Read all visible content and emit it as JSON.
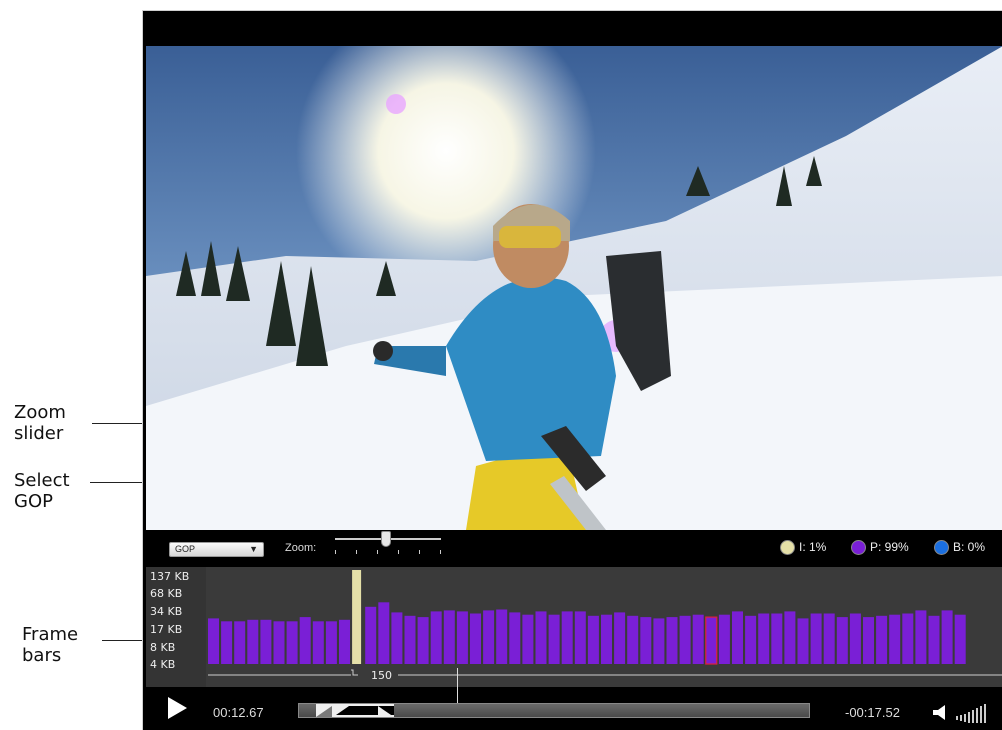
{
  "callouts": {
    "zoom": [
      "Zoom",
      "slider"
    ],
    "gop": [
      "Select",
      "GOP"
    ],
    "frames": [
      "Frame",
      "bars"
    ]
  },
  "controls": {
    "gop_select_value": "GOP",
    "zoom_label": "Zoom:",
    "zoom_level": 0.52,
    "legend": [
      {
        "label": "I: 1%",
        "color": "#e5e0a8"
      },
      {
        "label": "P: 99%",
        "color": "#7a1fd6"
      },
      {
        "label": "B: 0%",
        "color": "#1b6fe0"
      }
    ]
  },
  "graph": {
    "y_labels": [
      "137 KB",
      "68 KB",
      "34 KB",
      "17 KB",
      "8 KB",
      "4 KB"
    ],
    "gop_length_label": "150",
    "colors": {
      "p_frame": "#7a1fd6",
      "i_frame": "#e5e0a8",
      "selected": "#e0203a"
    },
    "frames": [
      {
        "type": "P",
        "size_kb": 17
      },
      {
        "type": "P",
        "size_kb": 15
      },
      {
        "type": "P",
        "size_kb": 15
      },
      {
        "type": "P",
        "size_kb": 16
      },
      {
        "type": "P",
        "size_kb": 16
      },
      {
        "type": "P",
        "size_kb": 15
      },
      {
        "type": "P",
        "size_kb": 15
      },
      {
        "type": "P",
        "size_kb": 18
      },
      {
        "type": "P",
        "size_kb": 15
      },
      {
        "type": "P",
        "size_kb": 15
      },
      {
        "type": "P",
        "size_kb": 16
      },
      {
        "type": "I",
        "size_kb": 137
      },
      {
        "type": "P",
        "size_kb": 28
      },
      {
        "type": "P",
        "size_kb": 34
      },
      {
        "type": "P",
        "size_kb": 22
      },
      {
        "type": "P",
        "size_kb": 19
      },
      {
        "type": "P",
        "size_kb": 18
      },
      {
        "type": "P",
        "size_kb": 23
      },
      {
        "type": "P",
        "size_kb": 24
      },
      {
        "type": "P",
        "size_kb": 23
      },
      {
        "type": "P",
        "size_kb": 21
      },
      {
        "type": "P",
        "size_kb": 24
      },
      {
        "type": "P",
        "size_kb": 25
      },
      {
        "type": "P",
        "size_kb": 22
      },
      {
        "type": "P",
        "size_kb": 20
      },
      {
        "type": "P",
        "size_kb": 23
      },
      {
        "type": "P",
        "size_kb": 20
      },
      {
        "type": "P",
        "size_kb": 23
      },
      {
        "type": "P",
        "size_kb": 23
      },
      {
        "type": "P",
        "size_kb": 19
      },
      {
        "type": "P",
        "size_kb": 20
      },
      {
        "type": "P",
        "size_kb": 22
      },
      {
        "type": "P",
        "size_kb": 19
      },
      {
        "type": "P",
        "size_kb": 18
      },
      {
        "type": "P",
        "size_kb": 17
      },
      {
        "type": "P",
        "size_kb": 18
      },
      {
        "type": "P",
        "size_kb": 19
      },
      {
        "type": "P",
        "size_kb": 20
      },
      {
        "type": "P",
        "size_kb": 18
      },
      {
        "type": "P",
        "size_kb": 20
      },
      {
        "type": "P",
        "size_kb": 23
      },
      {
        "type": "P",
        "size_kb": 19
      },
      {
        "type": "P",
        "size_kb": 21
      },
      {
        "type": "P",
        "size_kb": 21
      },
      {
        "type": "P",
        "size_kb": 23
      },
      {
        "type": "P",
        "size_kb": 17
      },
      {
        "type": "P",
        "size_kb": 21
      },
      {
        "type": "P",
        "size_kb": 21
      },
      {
        "type": "P",
        "size_kb": 18
      },
      {
        "type": "P",
        "size_kb": 21
      },
      {
        "type": "P",
        "size_kb": 18
      },
      {
        "type": "P",
        "size_kb": 19
      },
      {
        "type": "P",
        "size_kb": 20
      },
      {
        "type": "P",
        "size_kb": 21
      },
      {
        "type": "P",
        "size_kb": 24
      },
      {
        "type": "P",
        "size_kb": 19
      },
      {
        "type": "P",
        "size_kb": 24
      },
      {
        "type": "P",
        "size_kb": 20
      }
    ],
    "selected_frame_index": 38
  },
  "transport": {
    "elapsed": "00:12.67",
    "remaining": "-00:17.52",
    "timeline_window_fraction": [
      0.03,
      0.18
    ],
    "playhead_fraction": 0.59
  }
}
